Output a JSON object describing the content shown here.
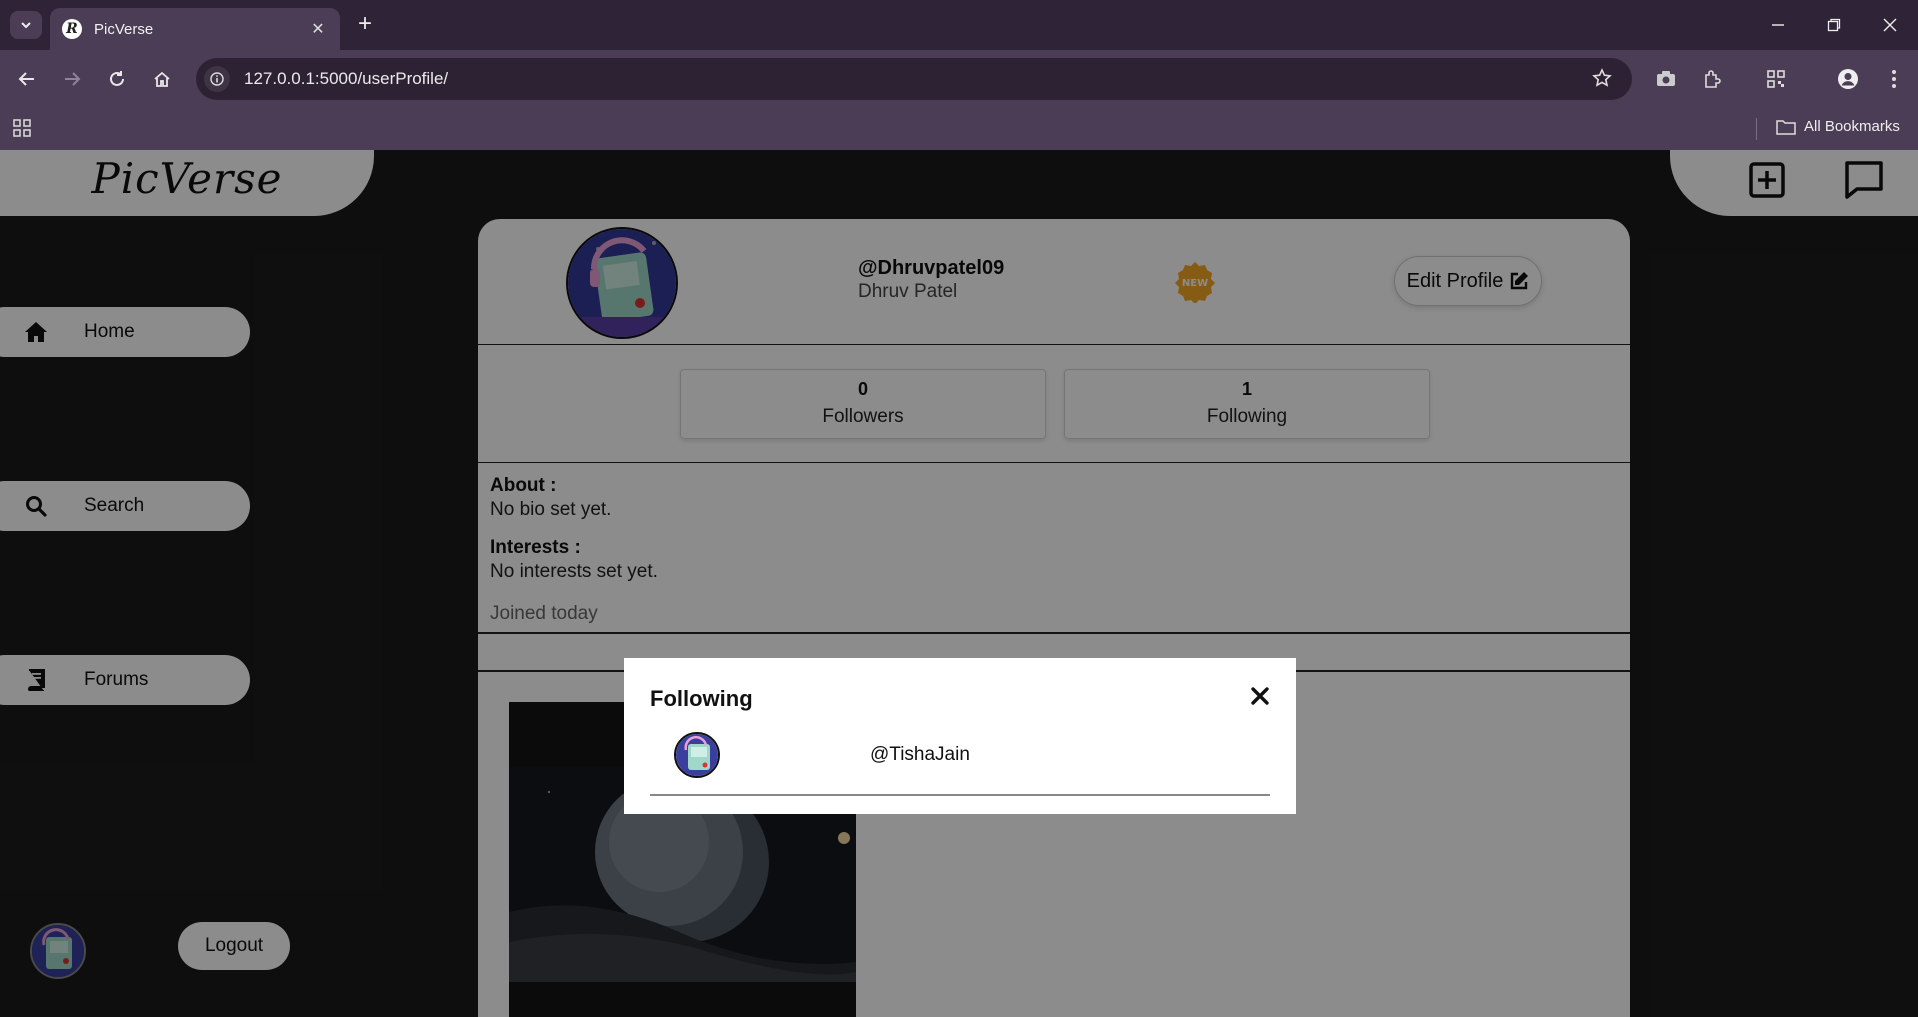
{
  "browser": {
    "tab_title": "PicVerse",
    "favicon_letter": "R",
    "url": "127.0.0.1:5000/userProfile/",
    "bookmarks_label": "All Bookmarks"
  },
  "app": {
    "logo": "PicVerse",
    "sidebar": {
      "items": [
        {
          "label": "Home",
          "icon": "home-icon"
        },
        {
          "label": "Search",
          "icon": "search-icon"
        },
        {
          "label": "Forums",
          "icon": "book-icon"
        }
      ],
      "logout_label": "Logout"
    }
  },
  "profile": {
    "handle": "@Dhruvpatel09",
    "full_name": "Dhruv Patel",
    "badge": "NEW",
    "edit_label": "Edit Profile",
    "stats": {
      "followers_count": "0",
      "followers_label": "Followers",
      "following_count": "1",
      "following_label": "Following"
    },
    "about_heading": "About :",
    "about_text": "No bio set yet.",
    "interests_heading": "Interests :",
    "interests_text": "No interests set yet.",
    "joined": "Joined today"
  },
  "modal": {
    "title": "Following",
    "items": [
      {
        "username": "@TishaJain"
      }
    ]
  },
  "colors": {
    "chrome_dark": "#2f2437",
    "chrome_toolbar": "#4a3d55",
    "app_background": "#1c1b1d",
    "badge_orange": "#f5a623"
  }
}
